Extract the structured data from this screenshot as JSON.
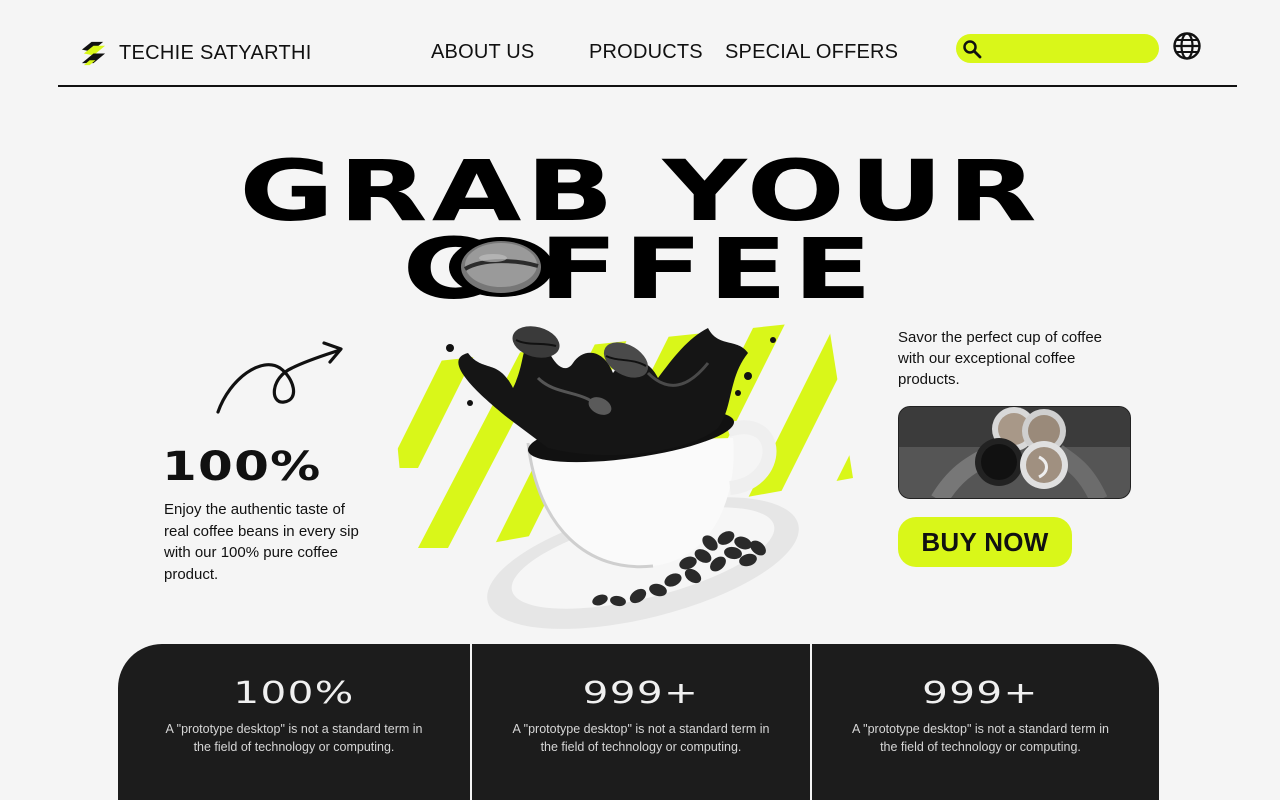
{
  "brand": {
    "name": "TECHIE SATYARTHI",
    "logo_icon": "brand-logo-icon"
  },
  "nav": {
    "links": [
      {
        "label": "ABOUT US"
      },
      {
        "label": "PRODUCTS"
      },
      {
        "label": "SPECIAL OFFERS"
      }
    ],
    "search": {
      "value": "",
      "placeholder": "",
      "icon": "search-icon"
    },
    "globe_icon": "globe-icon"
  },
  "hero": {
    "title_line1": "GRAB YOUR",
    "title_line2": "C FFEE"
  },
  "left": {
    "stat": "100%",
    "description": "Enjoy the authentic taste of real coffee beans in every sip with our 100% pure coffee product."
  },
  "right": {
    "description": "Savor the perfect cup of coffee with our exceptional coffee products.",
    "cta_label": "BUY NOW"
  },
  "stats": [
    {
      "value": "100%",
      "text": "A \"prototype desktop\" is not a standard term in the field of technology or computing."
    },
    {
      "value": "999+",
      "text": "A \"prototype desktop\" is not a standard term in the field of technology or computing."
    },
    {
      "value": "999+",
      "text": "A \"prototype desktop\" is not a standard term in the field of technology or computing."
    }
  ],
  "colors": {
    "accent": "#d9f719",
    "dark": "#1c1c1c",
    "background": "#f5f5f5"
  }
}
